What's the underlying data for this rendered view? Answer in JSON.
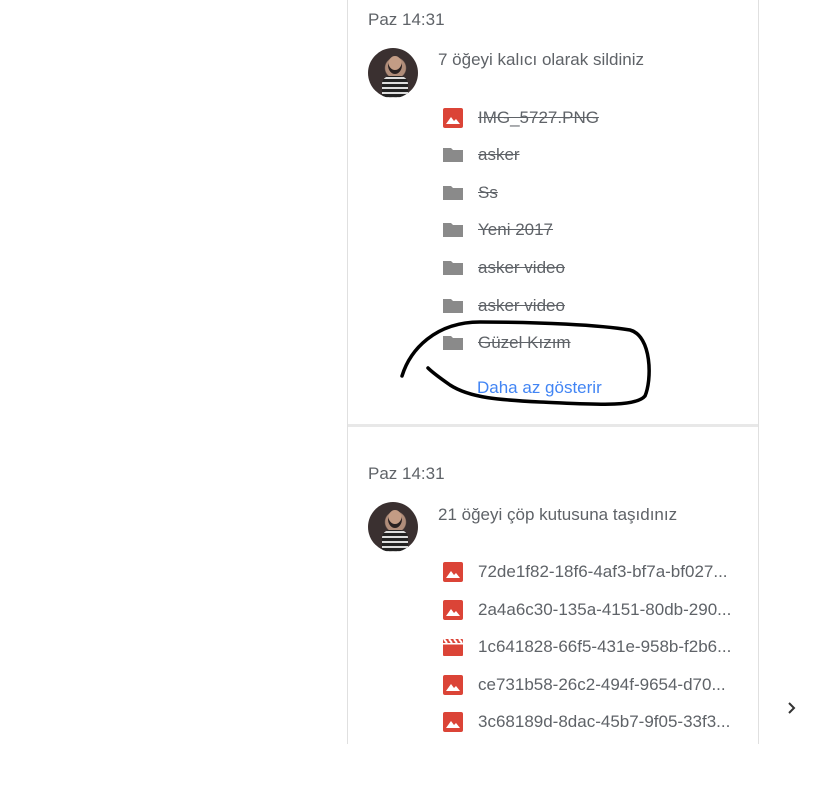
{
  "colors": {
    "image_icon": "#db4437",
    "folder_icon": "#8a8a8a",
    "link": "#4285f4",
    "text": "#5f6368",
    "annotation": "#000000"
  },
  "activities": [
    {
      "time": "Paz 14:31",
      "summary": "7 öğeyi kalıcı olarak sildiniz",
      "items": [
        {
          "icon": "image-icon",
          "name": "IMG_5727.PNG",
          "struck": true
        },
        {
          "icon": "folder-icon",
          "name": "asker",
          "struck": true
        },
        {
          "icon": "folder-icon",
          "name": "Ss",
          "struck": true
        },
        {
          "icon": "folder-icon",
          "name": "Yeni 2017",
          "struck": true
        },
        {
          "icon": "folder-icon",
          "name": "asker video",
          "struck": true
        },
        {
          "icon": "folder-icon",
          "name": "asker video",
          "struck": true
        },
        {
          "icon": "folder-icon",
          "name": "Güzel Kızım",
          "struck": true
        }
      ],
      "show_less": "Daha az gösterir"
    },
    {
      "time": "Paz 14:31",
      "summary": "21 öğeyi çöp kutusuna taşıdınız",
      "items": [
        {
          "icon": "image-icon",
          "name": "72de1f82-18f6-4af3-bf7a-bf027...",
          "struck": false
        },
        {
          "icon": "image-icon",
          "name": "2a4a6c30-135a-4151-80db-290...",
          "struck": false
        },
        {
          "icon": "video-icon",
          "name": "1c641828-66f5-431e-958b-f2b6...",
          "struck": false
        },
        {
          "icon": "image-icon",
          "name": "ce731b58-26c2-494f-9654-d70...",
          "struck": false
        },
        {
          "icon": "image-icon",
          "name": "3c68189d-8dac-45b7-9f05-33f3...",
          "struck": false
        }
      ]
    }
  ],
  "nav": {
    "next_icon": "chevron-right-icon"
  }
}
